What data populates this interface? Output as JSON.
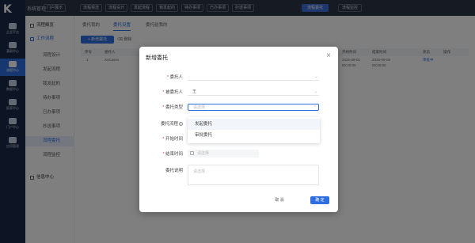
{
  "app": {
    "logo": "K",
    "system_label": "系统管理"
  },
  "top_tabs": [
    "门户展示",
    "流程报送",
    "流程设计",
    "发起流程",
    "我发起的",
    "待办事项",
    "已办事项",
    "抄送事项",
    "流程委托",
    "流程监控"
  ],
  "rail": [
    "企业平台",
    "基础中心",
    "流程中心",
    "数据中心",
    "报表中心",
    "门户中心",
    "应用管理"
  ],
  "sidebar": {
    "items": [
      {
        "label": "流程概览",
        "group": true
      },
      {
        "label": "工作流程",
        "group": true
      },
      {
        "label": "流程设计"
      },
      {
        "label": "发起流程"
      },
      {
        "label": "我发起的"
      },
      {
        "label": "待办事项"
      },
      {
        "label": "已办事项"
      },
      {
        "label": "抄送事项"
      },
      {
        "label": "流程委托"
      },
      {
        "label": "流程监控"
      },
      {
        "label": "信息中心",
        "group": true
      }
    ]
  },
  "main": {
    "subtabs": [
      "委托我的",
      "委托设置",
      "委托给我的"
    ],
    "add_label": "+ 新增委托",
    "delete_label": "删除",
    "columns": [
      "序号",
      "委托人",
      "被委托人",
      "委托流程",
      "开始时间",
      "结束时间",
      "状态",
      "操作"
    ],
    "row": {
      "index": "1",
      "delegator": "XuCases",
      "start": "2025-08-01 00:00:00",
      "end": "2025-09-05 00:00:00",
      "status": "审批中"
    }
  },
  "modal": {
    "title": "新增委托",
    "close_glyph": "×",
    "fields": {
      "delegator_label": "委托人",
      "delegatee_label": "被委托人",
      "delegatee_value": "王",
      "type_label": "委托类型",
      "type_placeholder": "请选择",
      "process_label": "委托流程",
      "start_label": "开始时间",
      "end_label": "结束时间",
      "end_placeholder": "请选择",
      "note_label": "委托说明",
      "note_placeholder": "请选择"
    },
    "dropdown": [
      "发起委托",
      "审批委托"
    ],
    "cancel_label": "取 消",
    "ok_label": "确 定"
  },
  "colors": {
    "primary": "#2f6ee0",
    "nav": "#2b3546",
    "rail": "#1b2a4a"
  }
}
